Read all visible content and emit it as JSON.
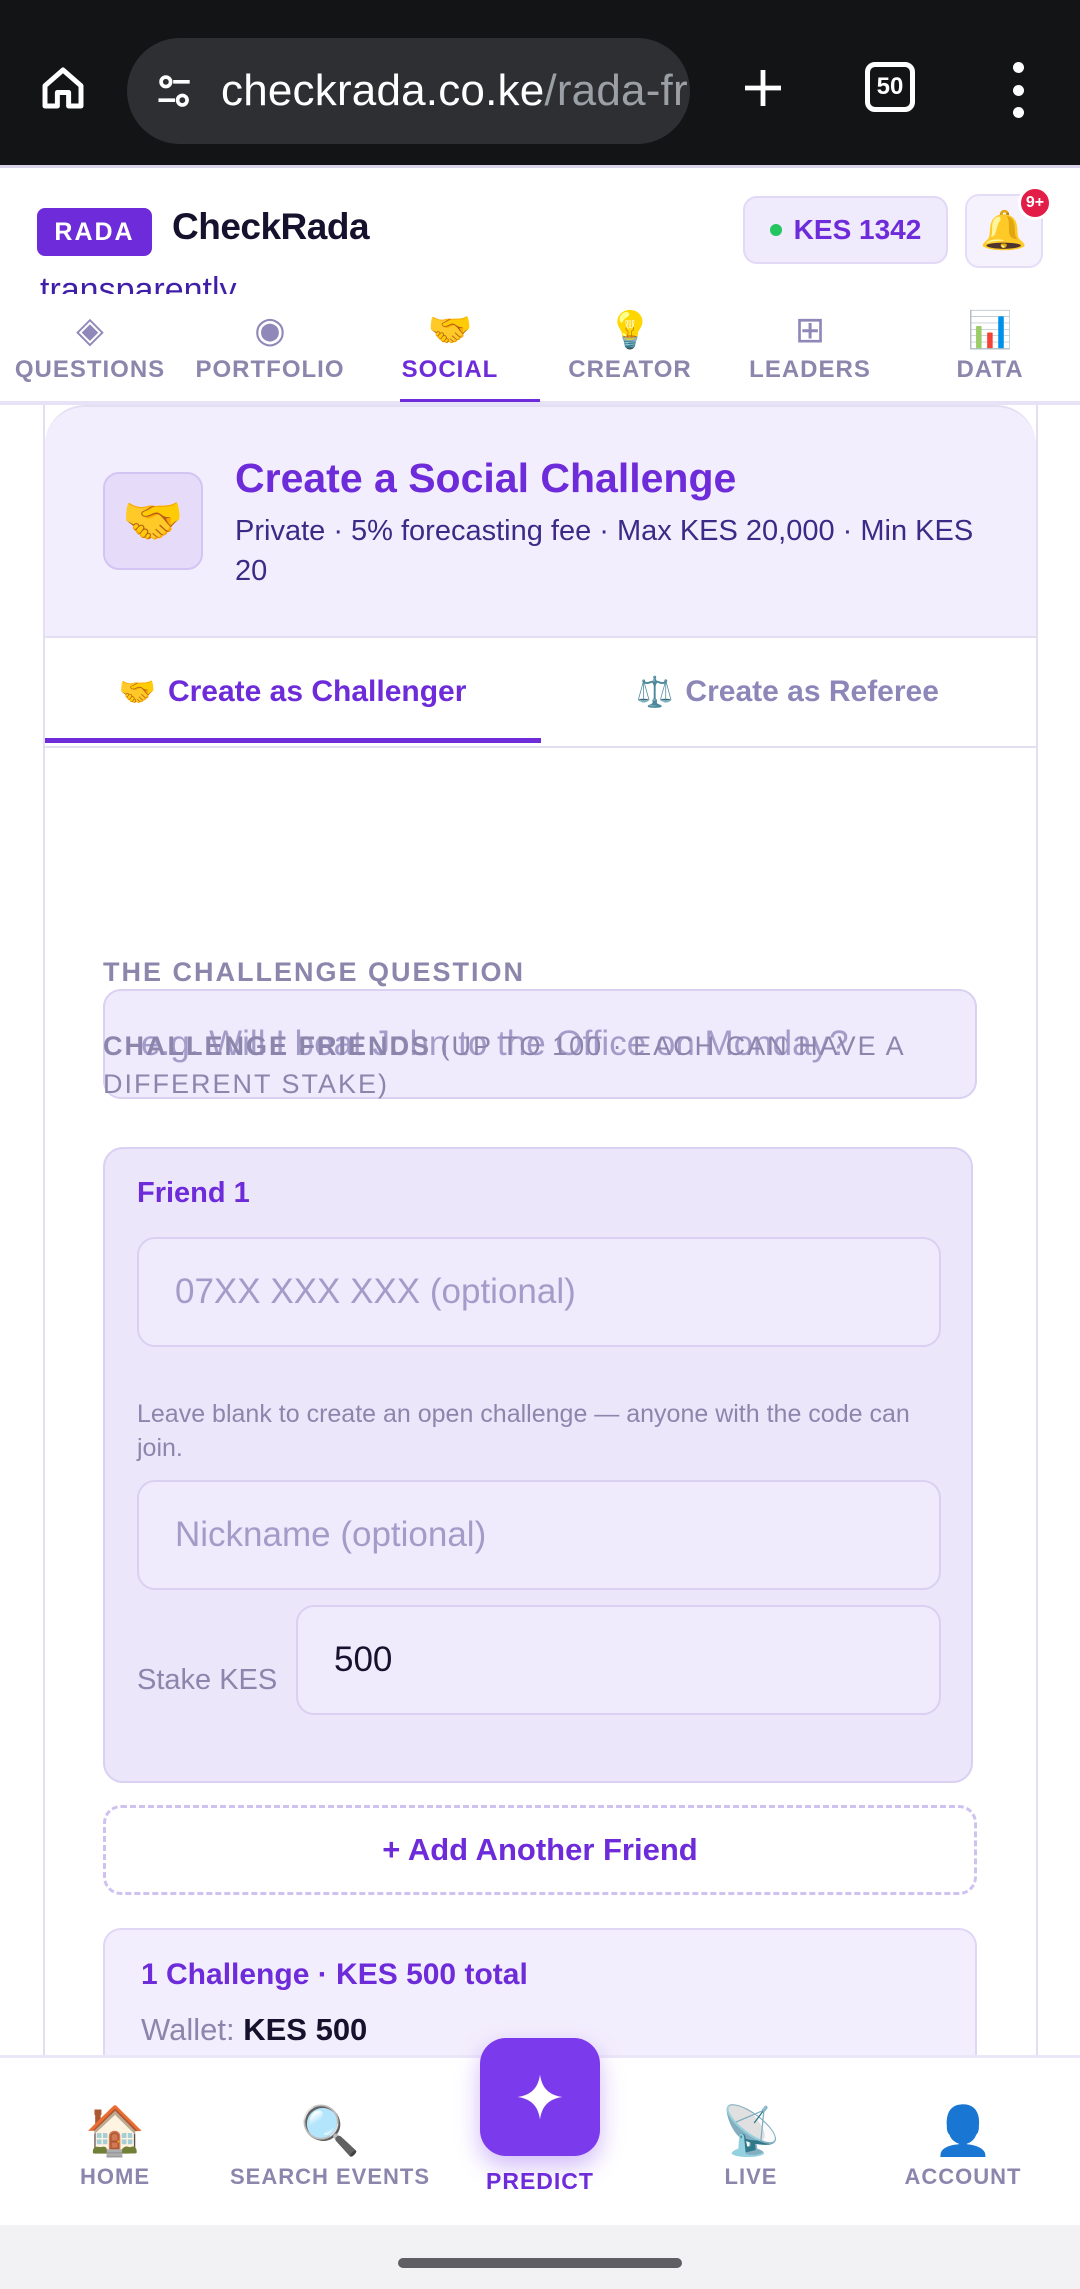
{
  "browser": {
    "url_host": "checkrada.co.ke",
    "url_path": "/rada-fr",
    "tab_count": "50",
    "icons": {
      "home": "home-icon",
      "site_settings": "tune-icon",
      "new_tab": "plus-icon",
      "menu": "more-vert-icon"
    }
  },
  "header": {
    "badge": "RADA",
    "brand": "CheckRada",
    "balance": "KES 1342",
    "notification_count": "9+",
    "peek_text": "transparently"
  },
  "nav_tabs": [
    {
      "icon": "◈",
      "label": "QUESTIONS"
    },
    {
      "icon": "◉",
      "label": "PORTFOLIO"
    },
    {
      "icon": "🤝",
      "label": "SOCIAL"
    },
    {
      "icon": "💡",
      "label": "CREATOR"
    },
    {
      "icon": "⊞",
      "label": "LEADERS"
    },
    {
      "icon": "📊",
      "label": "DATA"
    }
  ],
  "active_tab": "SOCIAL",
  "card": {
    "icon": "🤝",
    "title": "Create a Social Challenge",
    "subtitle": "Private · 5% forecasting fee · Max KES 20,000 · Min KES 20",
    "mode_tabs": {
      "challenger_icon": "🤝",
      "challenger": "Create as Challenger",
      "referee_icon": "⚖️",
      "referee": "Create as Referee"
    },
    "question_label": "THE CHALLENGE QUESTION",
    "question_placeholder": "e.g. Will I beat John to the Office on Monday?",
    "friends_label": "CHALLENGE FRIENDS",
    "friends_label_note": "(UP TO 100 · EACH CAN HAVE A DIFFERENT STAKE)",
    "friend": {
      "title": "Friend 1",
      "phone_placeholder": "07XX XXX XXX (optional)",
      "hint": "Leave blank to create an open challenge — anyone with the code can join.",
      "nickname_placeholder": "Nickname (optional)",
      "stake_label": "Stake KES",
      "stake_value": "500"
    },
    "add_friend": "+ Add Another Friend",
    "summary_title": "1 Challenge · KES 500 total",
    "summary_wallet_label": "Wallet:",
    "summary_wallet_value": "KES 500"
  },
  "bottom_nav": [
    {
      "icon": "🏠",
      "label": "HOME"
    },
    {
      "icon": "🔍",
      "label": "SEARCH EVENTS"
    },
    {
      "icon": "✦",
      "label": "PREDICT"
    },
    {
      "icon": "📡",
      "label": "LIVE"
    },
    {
      "icon": "👤",
      "label": "ACCOUNT"
    }
  ],
  "colors": {
    "accent": "#6d2bd9",
    "fab": "#7c3aed",
    "muted": "#8c86ad"
  }
}
